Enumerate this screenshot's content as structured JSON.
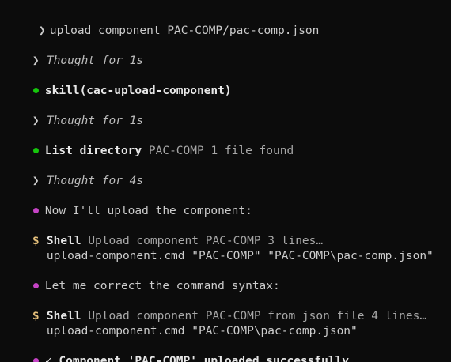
{
  "prompt": {
    "symbol": "❯",
    "command": "upload component PAC-COMP/pac-comp.json"
  },
  "colors": {
    "green_dot": "#16c60c",
    "magenta_dot": "#c543c5",
    "dollar": "#e5c07b"
  },
  "entries": {
    "thought1": {
      "symbol": "❯",
      "text": "Thought for 1s"
    },
    "skill": {
      "name": "skill(cac-upload-component)"
    },
    "thought2": {
      "symbol": "❯",
      "text": "Thought for 1s"
    },
    "listdir": {
      "tool": "List directory",
      "detail": "PAC-COMP 1 file found"
    },
    "thought3": {
      "symbol": "❯",
      "text": "Thought for 4s"
    },
    "msg1": {
      "text": "Now I'll upload the component:"
    },
    "shell1": {
      "symbol": "$",
      "tool": "Shell",
      "detail": "Upload component PAC-COMP 3 lines…",
      "cmd": "upload-component.cmd \"PAC-COMP\" \"PAC-COMP\\pac-comp.json\""
    },
    "msg2": {
      "text": "Let me correct the command syntax:"
    },
    "shell2": {
      "symbol": "$",
      "tool": "Shell",
      "detail": "Upload component PAC-COMP from json file 4 lines…",
      "cmd": "upload-component.cmd \"PAC-COMP\\pac-comp.json\""
    },
    "result": {
      "text": "✓ Component 'PAC-COMP' uploaded successfully."
    }
  }
}
